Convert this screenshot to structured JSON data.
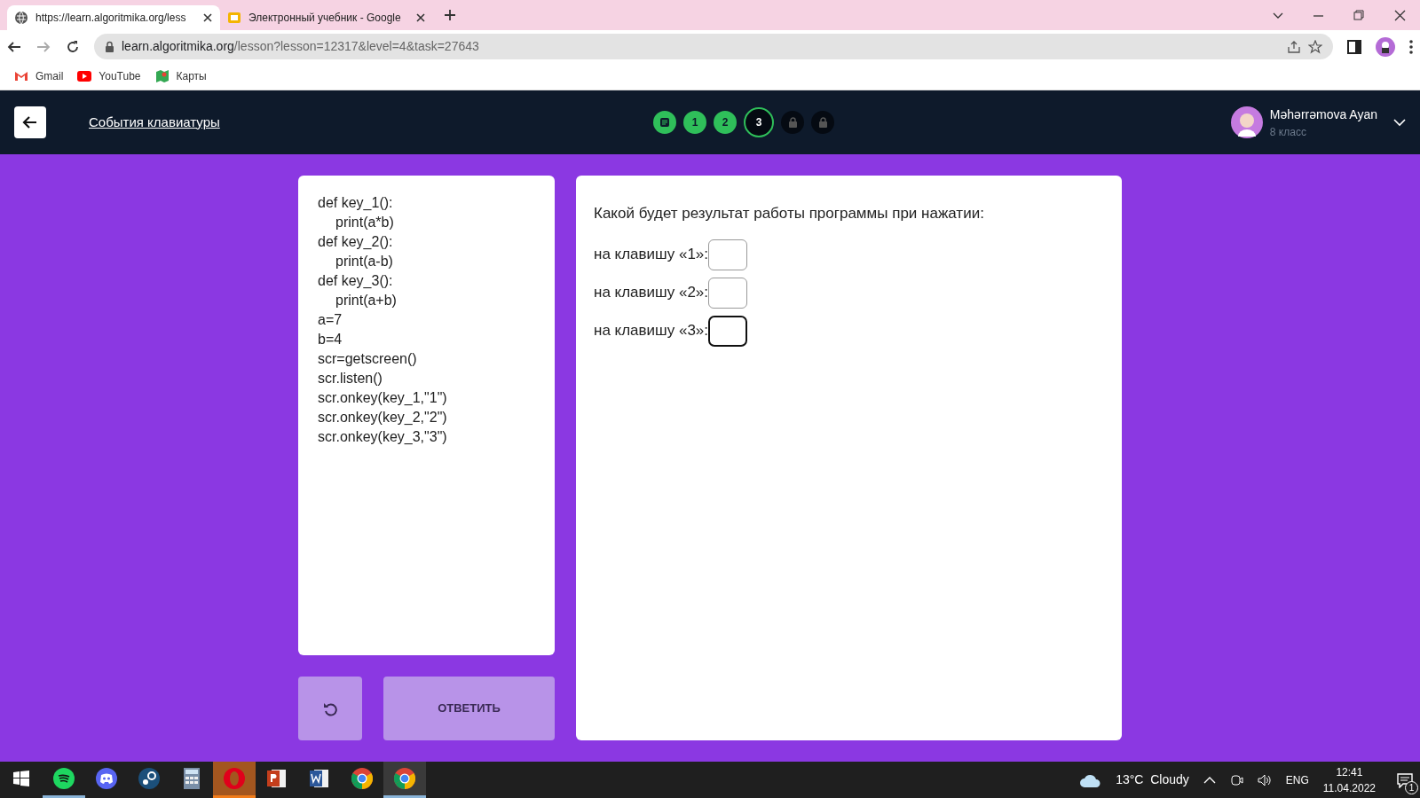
{
  "browser": {
    "tabs": [
      {
        "title": "https://learn.algoritmika.org/less",
        "kind": "globe",
        "selected": true
      },
      {
        "title": "Электронный учебник - Google",
        "kind": "slides",
        "selected": false
      }
    ],
    "url_host": "learn.algoritmika.org",
    "url_path": "/lesson?lesson=12317&level=4&task=27643",
    "bookmarks": [
      {
        "label": "Gmail",
        "kind": "gmail"
      },
      {
        "label": "YouTube",
        "kind": "youtube"
      },
      {
        "label": "Карты",
        "kind": "maps"
      }
    ]
  },
  "header": {
    "title": "События клавиатуры",
    "steps": [
      {
        "kind": "theory",
        "done": true,
        "selected": false
      },
      {
        "kind": "number",
        "label": "1",
        "done": true,
        "selected": false
      },
      {
        "kind": "number",
        "label": "2",
        "done": true,
        "selected": false
      },
      {
        "kind": "number",
        "label": "3",
        "done": false,
        "selected": true
      },
      {
        "kind": "locked",
        "done": false,
        "selected": false
      },
      {
        "kind": "locked",
        "done": false,
        "selected": false
      }
    ],
    "user": {
      "name": "Məhərrəmova Ayan",
      "grade": "8 класс"
    }
  },
  "code_lines": [
    {
      "text": "def key_1():",
      "children": [
        {
          "text": "print(a*b)"
        }
      ]
    },
    {
      "text": "def key_2():",
      "children": [
        {
          "text": "print(a-b)"
        }
      ]
    },
    {
      "text": "def key_3():",
      "children": [
        {
          "text": "print(a+b)"
        }
      ]
    },
    {
      "text": "a=7"
    },
    {
      "text": "b=4"
    },
    {
      "text": "scr=getscreen()"
    },
    {
      "text": "scr.listen()"
    },
    {
      "text": "scr.onkey(key_1,\"1\")"
    },
    {
      "text": "scr.onkey(key_2,\"2\")"
    },
    {
      "text": "scr.onkey(key_3,\"3\")"
    }
  ],
  "buttons": {
    "answer": "ОТВЕТИТЬ"
  },
  "question": "Какой будет результат работы программы при нажатии:",
  "answers": [
    {
      "label": "на клавишу «1»:",
      "focused": false
    },
    {
      "label": "на клавишу «2»:",
      "focused": false
    },
    {
      "label": "на клавишу «3»:",
      "focused": true
    }
  ],
  "taskbar": {
    "apps": [
      {
        "kind": "spotify",
        "running": true,
        "selected": false,
        "attention": false
      },
      {
        "kind": "discord",
        "running": false,
        "selected": false,
        "attention": false
      },
      {
        "kind": "steam",
        "running": false,
        "selected": false,
        "attention": false
      },
      {
        "kind": "calculator",
        "running": false,
        "selected": false,
        "attention": false
      },
      {
        "kind": "opera",
        "running": true,
        "selected": false,
        "attention": true
      },
      {
        "kind": "powerpoint",
        "running": false,
        "selected": false,
        "attention": false
      },
      {
        "kind": "word",
        "running": false,
        "selected": false,
        "attention": false
      },
      {
        "kind": "chrome",
        "running": false,
        "selected": false,
        "attention": false
      },
      {
        "kind": "chrome",
        "running": true,
        "selected": true,
        "attention": false
      }
    ],
    "weather": "13°C  Cloudy",
    "language": "ENG",
    "time": "12:41",
    "date": "11.04.2022",
    "notifications": "1"
  }
}
